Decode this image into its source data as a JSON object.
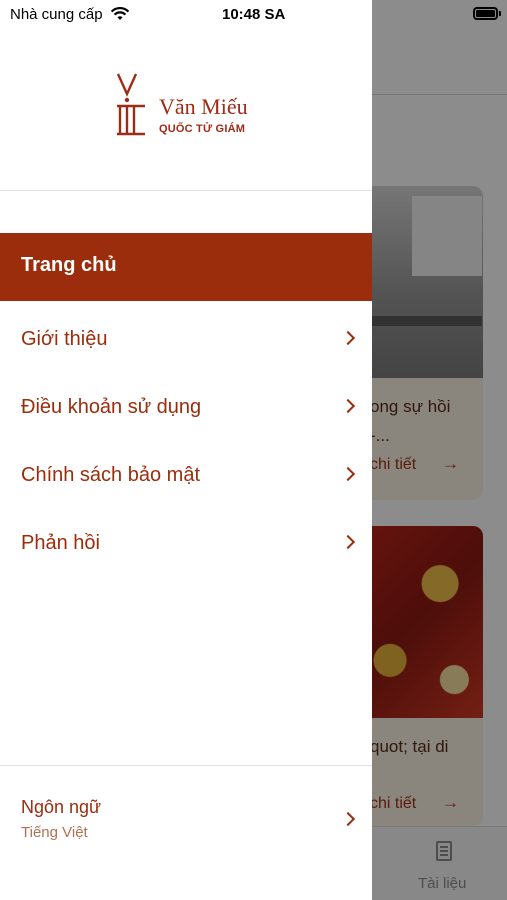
{
  "status_bar": {
    "carrier": "Nhà cung cấp",
    "time": "10:48 SA"
  },
  "logo": {
    "title": "Văn Miếu",
    "subtitle": "QUỐC TỬ GIÁM"
  },
  "menu": {
    "items": [
      {
        "label": "Trang chủ",
        "active": true
      },
      {
        "label": "Giới thiệu",
        "active": false
      },
      {
        "label": "Điều khoản sử dụng",
        "active": false
      },
      {
        "label": "Chính sách bảo mật",
        "active": false
      },
      {
        "label": "Phản hồi",
        "active": false
      }
    ]
  },
  "language": {
    "title": "Ngôn ngữ",
    "value": "Tiếng Việt"
  },
  "background": {
    "card1": {
      "text1": "ong sự hồi",
      "text2": "-...",
      "link": "chi tiết"
    },
    "card2": {
      "text1": "quot; tại di",
      "link": "chi tiết"
    },
    "tabbar": {
      "doc_label": "Tài liệu"
    }
  },
  "colors": {
    "accent": "#9c2d0c",
    "active_bg": "#9c2d0c"
  }
}
